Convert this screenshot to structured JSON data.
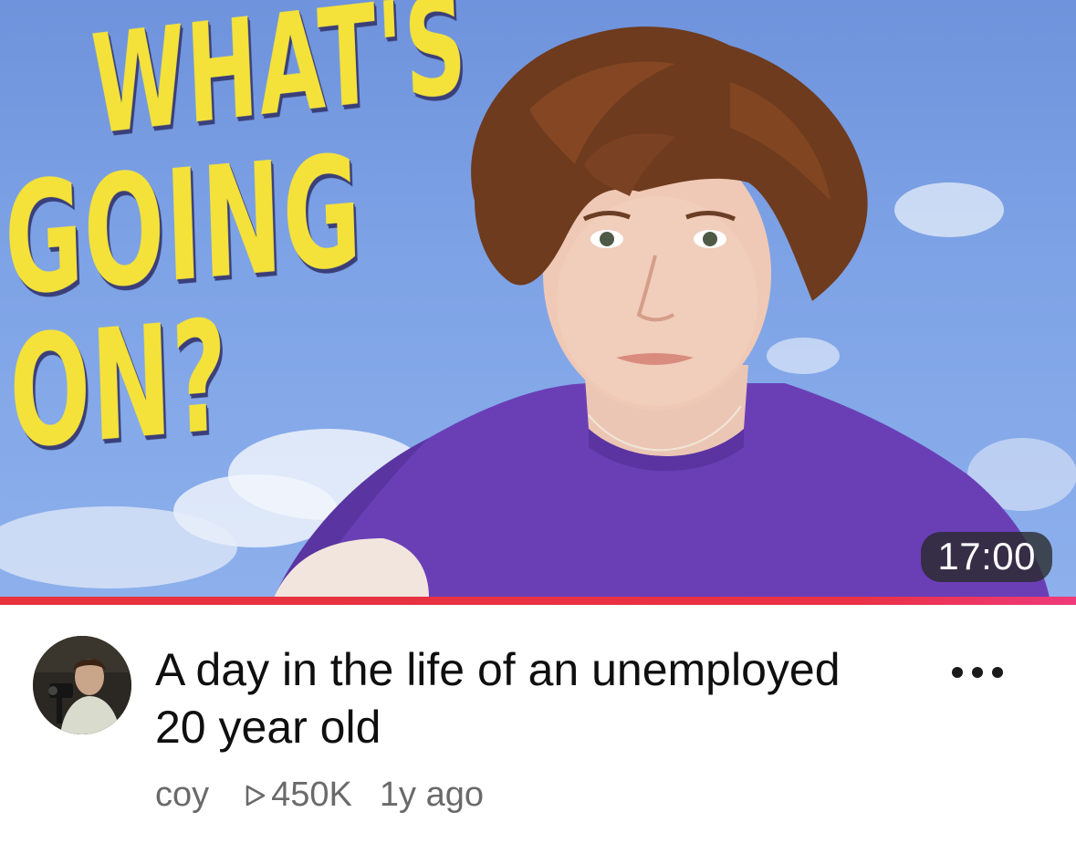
{
  "thumbnail": {
    "headline_line1": "WHAT'S",
    "headline_line2": "GOING ON?",
    "duration": "17:00",
    "watch_progress": 1.0,
    "progress_color": "#e8323d",
    "text_color": "#f4e23a"
  },
  "video": {
    "title": "A day in the life of an unemployed 20 year old",
    "channel": "coy",
    "views": "450K",
    "age": "1y ago",
    "views_icon": "play-outline-icon",
    "more_icon": "more-options-icon"
  }
}
